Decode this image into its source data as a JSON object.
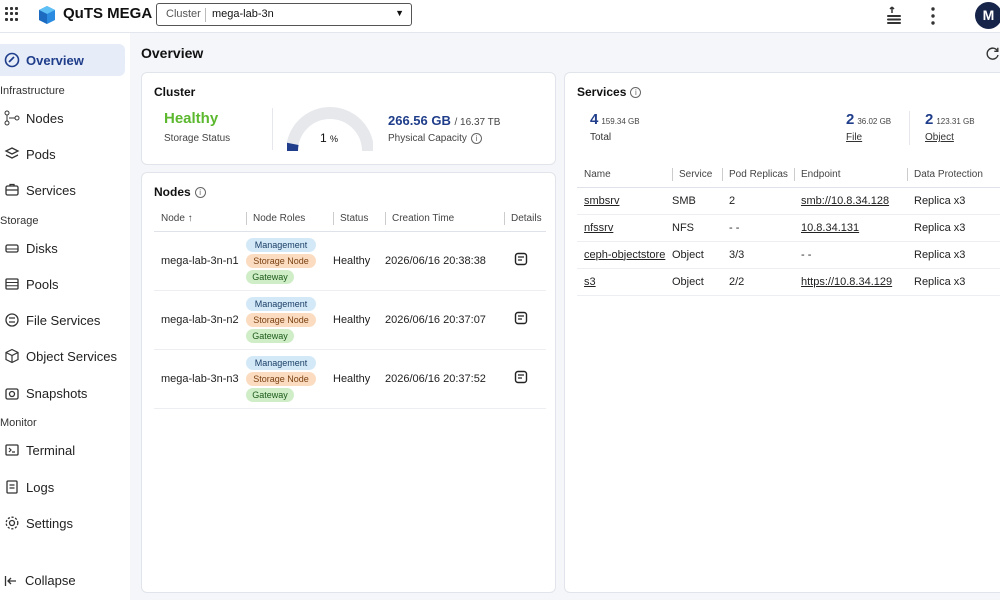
{
  "header": {
    "app_title": "QuTS MEGA",
    "cluster_label": "Cluster",
    "cluster_value": "mega-lab-3n",
    "avatar_initial": "M"
  },
  "sidebar": {
    "items": [
      {
        "label": "Overview",
        "icon": "overview-icon"
      },
      {
        "label": "Nodes",
        "icon": "nodes-icon"
      },
      {
        "label": "Pods",
        "icon": "pods-icon"
      },
      {
        "label": "Services",
        "icon": "services-icon"
      },
      {
        "label": "Disks",
        "icon": "disks-icon"
      },
      {
        "label": "Pools",
        "icon": "pools-icon"
      },
      {
        "label": "File Services",
        "icon": "file-services-icon"
      },
      {
        "label": "Object Services",
        "icon": "object-services-icon"
      },
      {
        "label": "Snapshots",
        "icon": "snapshots-icon"
      },
      {
        "label": "Terminal",
        "icon": "terminal-icon"
      },
      {
        "label": "Logs",
        "icon": "logs-icon"
      },
      {
        "label": "Settings",
        "icon": "settings-icon"
      }
    ],
    "sections": [
      "Infrastructure",
      "Storage",
      "Monitor"
    ],
    "collapse_label": "Collapse"
  },
  "main": {
    "title": "Overview",
    "cluster_card": {
      "title": "Cluster",
      "status": "Healthy",
      "status_label": "Storage Status",
      "usage_percent": 1,
      "usage_percent_text": "1",
      "percent_unit": "%",
      "used": "266.56 GB",
      "total": "/ 16.37 TB",
      "capacity_label": "Physical Capacity"
    },
    "nodes_card": {
      "title": "Nodes",
      "columns": [
        "Node ↑",
        "Node Roles",
        "Status",
        "Creation Time",
        "Details"
      ],
      "rows": [
        {
          "node": "mega-lab-3n-n1",
          "roles": [
            "Management",
            "Storage Node",
            "Gateway"
          ],
          "status": "Healthy",
          "created": "2026/06/16 20:38:38"
        },
        {
          "node": "mega-lab-3n-n2",
          "roles": [
            "Management",
            "Storage Node",
            "Gateway"
          ],
          "status": "Healthy",
          "created": "2026/06/16 20:37:07"
        },
        {
          "node": "mega-lab-3n-n3",
          "roles": [
            "Management",
            "Storage Node",
            "Gateway"
          ],
          "status": "Healthy",
          "created": "2026/06/16 20:37:52"
        }
      ]
    },
    "services_card": {
      "title": "Services",
      "total": {
        "count": "4",
        "size": "159.34 GB",
        "label": "Total"
      },
      "file": {
        "count": "2",
        "size": "36.02 GB",
        "label": "File"
      },
      "object": {
        "count": "2",
        "size": "123.31 GB",
        "label": "Object"
      },
      "columns": [
        "Name",
        "Service",
        "Pod Replicas",
        "Endpoint",
        "Data Protection"
      ],
      "rows": [
        {
          "name": "smbsrv",
          "service": "SMB",
          "replicas": "2",
          "endpoint": "smb://10.8.34.128",
          "protection": "Replica x3"
        },
        {
          "name": "nfssrv",
          "service": "NFS",
          "replicas": "- -",
          "endpoint": "10.8.34.131",
          "protection": "Replica x3"
        },
        {
          "name": "ceph-objectstore",
          "service": "Object",
          "replicas": "3/3",
          "endpoint": "- -",
          "protection": "Replica x3"
        },
        {
          "name": "s3",
          "service": "Object",
          "replicas": "2/2",
          "endpoint": "https://10.8.34.129",
          "protection": "Replica x3"
        }
      ]
    }
  },
  "colors": {
    "accent": "#1f3d8a",
    "healthy": "#5cb82f",
    "active_bg": "#e6edf9"
  }
}
